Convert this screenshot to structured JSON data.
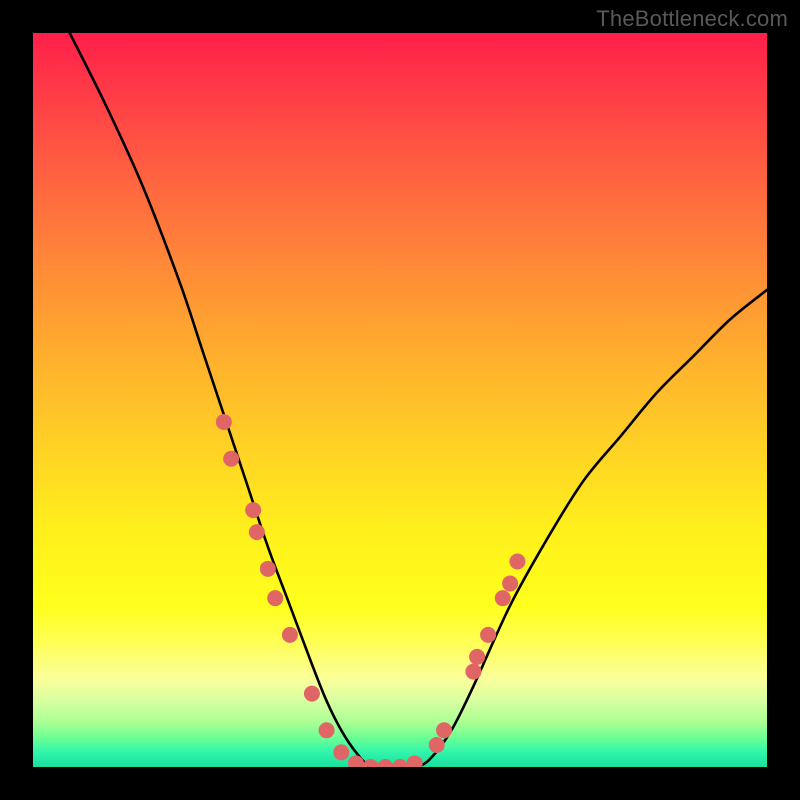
{
  "watermark": "TheBottleneck.com",
  "chart_data": {
    "type": "line",
    "title": "",
    "xlabel": "",
    "ylabel": "",
    "xlim": [
      0,
      100
    ],
    "ylim": [
      0,
      100
    ],
    "grid": false,
    "legend": false,
    "series": [
      {
        "name": "bottleneck-curve",
        "x": [
          5,
          10,
          15,
          20,
          23,
          26,
          29,
          32,
          35,
          38,
          40,
          42,
          44,
          46,
          48,
          50,
          52,
          54,
          57,
          60,
          65,
          70,
          75,
          80,
          85,
          90,
          95,
          100
        ],
        "y": [
          100,
          90,
          79,
          66,
          57,
          48,
          39,
          30,
          22,
          14,
          9,
          5,
          2,
          0,
          0,
          0,
          0,
          1,
          5,
          11,
          22,
          31,
          39,
          45,
          51,
          56,
          61,
          65
        ]
      }
    ],
    "markers": {
      "name": "data-points",
      "color": "#e06666",
      "radius_px": 8,
      "points_xy": [
        [
          26,
          47
        ],
        [
          27,
          42
        ],
        [
          30,
          35
        ],
        [
          30.5,
          32
        ],
        [
          32,
          27
        ],
        [
          33,
          23
        ],
        [
          35,
          18
        ],
        [
          38,
          10
        ],
        [
          40,
          5
        ],
        [
          42,
          2
        ],
        [
          44,
          0.5
        ],
        [
          46,
          0
        ],
        [
          48,
          0
        ],
        [
          50,
          0
        ],
        [
          52,
          0.5
        ],
        [
          55,
          3
        ],
        [
          56,
          5
        ],
        [
          60,
          13
        ],
        [
          60.5,
          15
        ],
        [
          62,
          18
        ],
        [
          64,
          23
        ],
        [
          65,
          25
        ],
        [
          66,
          28
        ]
      ]
    },
    "background_gradient": {
      "top": "#ff1f4a",
      "mid": "#ffff1c",
      "bottom": "#1adf9e"
    }
  }
}
